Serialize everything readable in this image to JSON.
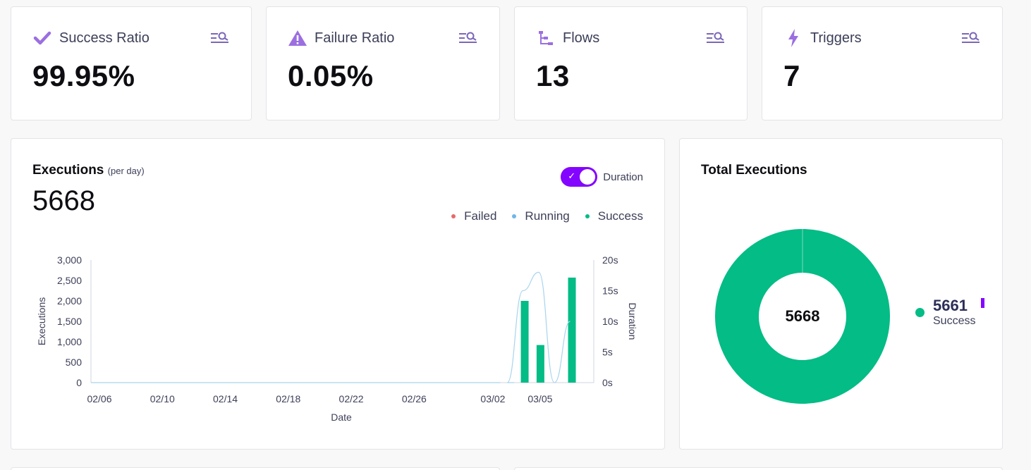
{
  "stats": [
    {
      "title": "Success Ratio",
      "value": "99.95%",
      "icon": "check-icon"
    },
    {
      "title": "Failure Ratio",
      "value": "0.05%",
      "icon": "warning-icon"
    },
    {
      "title": "Flows",
      "value": "13",
      "icon": "flows-icon"
    },
    {
      "title": "Triggers",
      "value": "7",
      "icon": "lightning-icon"
    }
  ],
  "executions": {
    "title": "Executions",
    "subtitle": "(per day)",
    "total": "5668",
    "toggle_label": "Duration",
    "toggle_on": true,
    "legend": [
      {
        "label": "Failed",
        "color": "#e86a6a"
      },
      {
        "label": "Running",
        "color": "#6fb6e8"
      },
      {
        "label": "Success",
        "color": "#03bc86"
      }
    ]
  },
  "total_executions": {
    "title": "Total Executions",
    "center_value": "5668",
    "legend_value": "5661",
    "legend_label": "Success",
    "success_color": "#03bc86",
    "accent_color": "#8405ff"
  },
  "chart_data": {
    "type": "bar",
    "xlabel": "Date",
    "ylabel": "Executions",
    "y2label": "Duration",
    "x_ticks": [
      "02/06",
      "02/10",
      "02/14",
      "02/18",
      "02/22",
      "02/26",
      "03/02",
      "03/05"
    ],
    "y_ticks": [
      "0",
      "500",
      "1,000",
      "1,500",
      "2,000",
      "2,500",
      "3,000"
    ],
    "y2_ticks": [
      "0s",
      "5s",
      "10s",
      "15s",
      "20s"
    ],
    "ylim": [
      0,
      3000
    ],
    "y2lim": [
      0,
      20
    ],
    "series": [
      {
        "name": "Success",
        "color": "#03bc86",
        "bars": [
          {
            "date": "03/04",
            "value": 2000
          },
          {
            "date": "03/05",
            "value": 920
          },
          {
            "date": "03/07",
            "value": 2570
          }
        ]
      },
      {
        "name": "Duration",
        "color": "#a8d4ee",
        "line": [
          {
            "date": "03/03",
            "value": 0
          },
          {
            "date": "03/04",
            "value": 15
          },
          {
            "date": "03/05",
            "value": 18
          },
          {
            "date": "03/06",
            "value": 0
          },
          {
            "date": "03/07",
            "value": 10
          }
        ]
      }
    ]
  }
}
